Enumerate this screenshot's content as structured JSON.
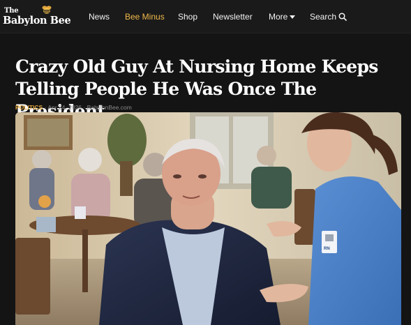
{
  "site": {
    "logo_the": "The",
    "logo_name": "Babylon Bee",
    "logo_icon": "bee-icon"
  },
  "nav": {
    "items": [
      {
        "label": "News"
      },
      {
        "label": "Bee Minus"
      },
      {
        "label": "Shop"
      },
      {
        "label": "Newsletter"
      },
      {
        "label": "More"
      },
      {
        "label": "Search"
      }
    ],
    "active_color": "#f0b94a"
  },
  "article": {
    "title": "Crazy Old Guy At Nursing Home Keeps Telling People He Was Once The President",
    "category": "POLITICS",
    "separator": "·",
    "date": "Apr 24, 2026",
    "source": "BabylonBee.com",
    "badge_text": "RN"
  },
  "colors": {
    "background": "#141414",
    "category": "#e0a53c",
    "headline": "#ffffff"
  }
}
